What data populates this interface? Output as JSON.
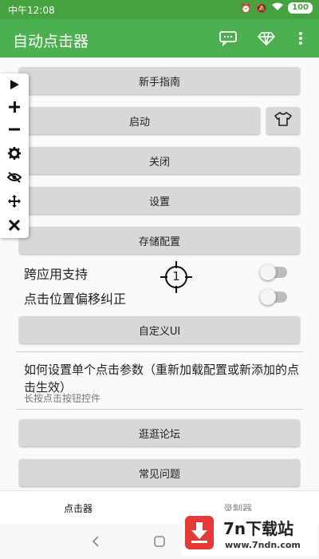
{
  "status_bar": {
    "time": "中午12:08",
    "battery": "100"
  },
  "app_bar": {
    "title": "自动点击器"
  },
  "buttons": {
    "guide": "新手指南",
    "start": "启动",
    "close": "关闭",
    "settings": "设置",
    "save_config": "存储配置",
    "custom_ui": "自定义UI",
    "forum": "逛逛论坛",
    "faq": "常见问题"
  },
  "toggles": {
    "cross_app": {
      "label": "跨应用支持",
      "on": false
    },
    "offset": {
      "label": "点击位置偏移纠正",
      "on": false
    }
  },
  "target_number": "1",
  "help": {
    "title": "如何设置单个点击参数（重新加载配置或新添加的点击生效）",
    "subtitle": "长按点击按钮控件"
  },
  "bottom_nav": {
    "tab1": "点击器",
    "tab2": "录制器"
  },
  "watermark": {
    "title": "7n下载站",
    "url": "www.7ndn.com"
  },
  "colors": {
    "primary": "#4caf50",
    "status": "#46a13f",
    "button": "#d8d8d8",
    "watermark_red": "#e53935"
  }
}
